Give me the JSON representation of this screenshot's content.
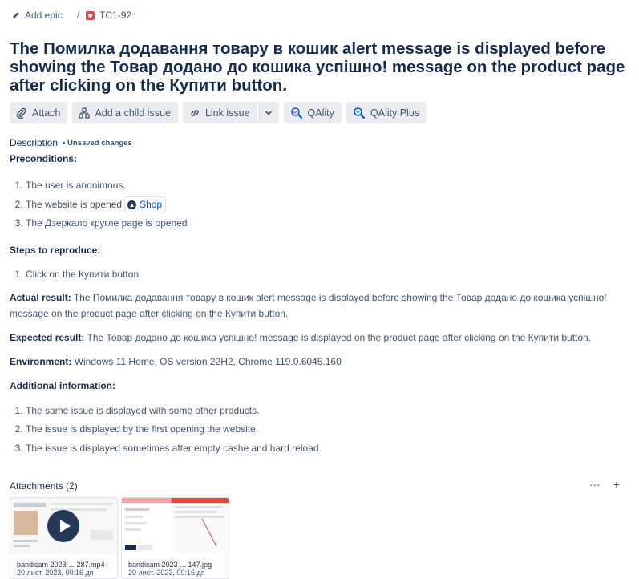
{
  "breadcrumb": {
    "epic": "Add epic",
    "separator": "/",
    "issue_key": "TC1-92"
  },
  "title": "The Помилка додавання товару в кошик alert message is displayed before showing the Товар додано до кошика успішно! message on the product page after clicking on the Купити button.",
  "toolbar": {
    "attach": "Attach",
    "child_issue": "Add a child issue",
    "link_issue": "Link issue",
    "qality": "QAlity",
    "qality_plus": "QAlity Plus"
  },
  "description": {
    "label": "Description",
    "unsaved": "• Unsaved changes",
    "preconditions_label": "Preconditions:",
    "preconditions": {
      "p1": "The user is anonimous.",
      "p2": "The website is opened",
      "p2_link": "Shop",
      "p3": "The Дзеркало кругле page is opened"
    },
    "steps_label": "Steps to reproduce:",
    "steps": {
      "s1": "Click on the Купити button"
    },
    "actual_label": "Actual result:",
    "actual_text": "The Помилка додавання товару в кошик alert message is displayed before showing the Товар додано до кошика успішно! message on the product page after clicking on the Купити button.",
    "expected_label": "Expected result:",
    "expected_text": "The Товар додано до кошика успішно! message is displayed on the product page after clicking on the Купити button.",
    "environment_label": "Environment:",
    "environment_text": "Windows 11 Home, OS version 22H2, Chrome 119.0.6045.160",
    "additional_label": "Additional information:",
    "additional": {
      "a1": "The same issue is displayed with some other products.",
      "a2": "The issue is displayed by the first opening the website.",
      "a3": "The issue is displayed sometimes after empty cashe and hard reload."
    }
  },
  "attachments": {
    "label": "Attachments (2)",
    "more": "···",
    "add": "+",
    "file1": {
      "name": "bandicam 2023-... 287.mp4",
      "date": "20 лист. 2023, 00:16 дп"
    },
    "file2": {
      "name": "bandicam 2023-... 147.jpg",
      "date": "20 лист. 2023, 00:16 дп"
    }
  },
  "colors": {
    "accent": "#0052cc",
    "bug": "#e5493a",
    "button_bg": "#ebecf0",
    "text": "#172b4d"
  }
}
